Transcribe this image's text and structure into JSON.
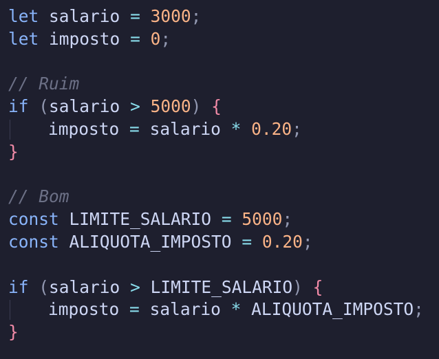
{
  "editor": {
    "lines": [
      {
        "t1": "let",
        "t2": "salario",
        "t3": "=",
        "t4": "3000",
        "t5": ";"
      },
      {
        "t1": "let",
        "t2": "imposto",
        "t3": "=",
        "t4": "0",
        "t5": ";"
      },
      {},
      {
        "comment": "// Ruim"
      },
      {
        "kw": "if",
        "p1": "(",
        "a": "salario",
        "op": ">",
        "n": "5000",
        "p2": ")",
        "br": "{"
      },
      {
        "a": "imposto",
        "eq": "=",
        "b": "salario",
        "op": "*",
        "n": "0.20",
        "semi": ";"
      },
      {
        "br": "}"
      },
      {},
      {
        "comment": "// Bom"
      },
      {
        "t1": "const",
        "t2": "LIMITE_SALARIO",
        "t3": "=",
        "t4": "5000",
        "t5": ";"
      },
      {
        "t1": "const",
        "t2": "ALIQUOTA_IMPOSTO",
        "t3": "=",
        "t4": "0.20",
        "t5": ";"
      },
      {},
      {
        "kw": "if",
        "p1": "(",
        "a": "salario",
        "op": ">",
        "b": "LIMITE_SALARIO",
        "p2": ")",
        "br": "{"
      },
      {
        "a": "imposto",
        "eq": "=",
        "b": "salario",
        "op": "*",
        "c": "ALIQUOTA_IMPOSTO",
        "semi": ";"
      },
      {
        "br": "}"
      }
    ]
  },
  "colors": {
    "background": "#1e1f2e",
    "keyword": "#89b4fa",
    "number": "#fab387",
    "operator": "#89dceb",
    "brace": "#f38ba8",
    "comment": "#6c7086",
    "identifier": "#cdd6f4"
  }
}
